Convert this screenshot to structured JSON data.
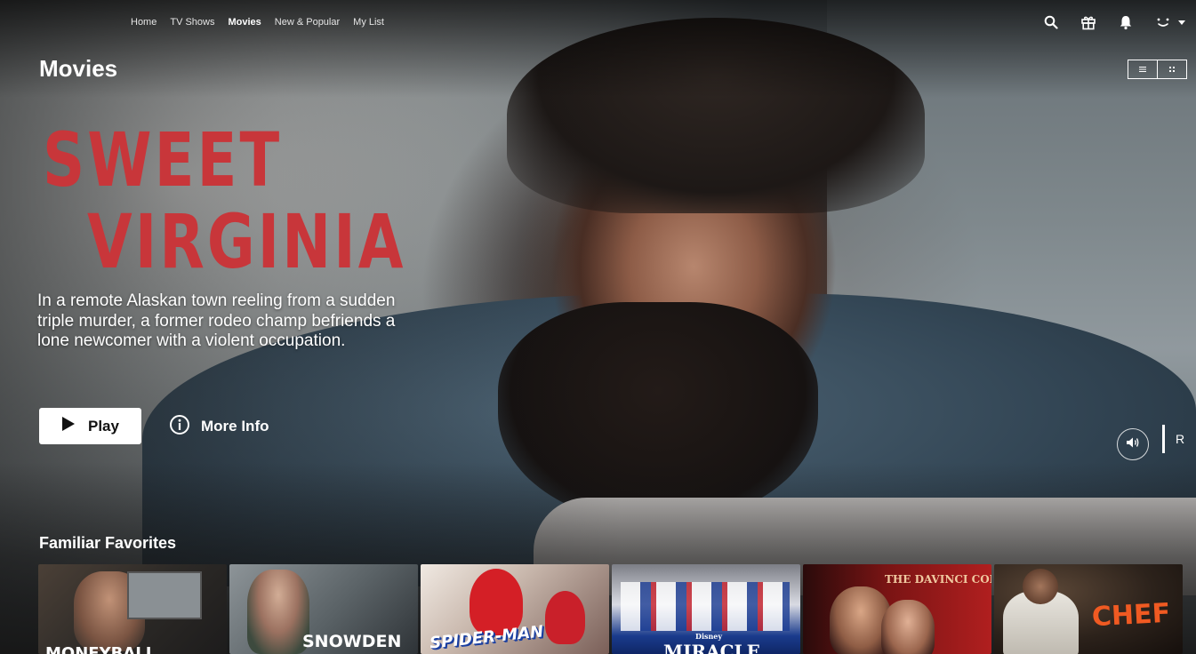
{
  "nav": {
    "links": [
      {
        "label": "Home",
        "active": false
      },
      {
        "label": "TV Shows",
        "active": false
      },
      {
        "label": "Movies",
        "active": true
      },
      {
        "label": "New & Popular",
        "active": false
      },
      {
        "label": "My List",
        "active": false
      }
    ],
    "icons": [
      "search-icon",
      "gift-icon",
      "bell-icon",
      "profile-avatar",
      "caret-down-icon"
    ]
  },
  "page": {
    "title": "Movies"
  },
  "hero": {
    "title_line1": "SWEET",
    "title_line2": "VIRGINIA",
    "synopsis": "In a remote Alaskan town reeling from a sudden triple murder, a former rodeo champ befriends a lone newcomer with a violent occupation.",
    "play_label": "Play",
    "info_label": "More Info",
    "rating": "R",
    "title_color": "#c8363a"
  },
  "row": {
    "title": "Familiar Favorites",
    "tiles": [
      {
        "name": "Moneyball",
        "text": "MONEYBALL"
      },
      {
        "name": "Snowden",
        "text": "SNOWDEN"
      },
      {
        "name": "Spider-Man",
        "text": "SPIDER-MAN"
      },
      {
        "name": "Miracle",
        "text": "MIRACLE",
        "badge": "Disney"
      },
      {
        "name": "The Da Vinci Code",
        "text": "THE DAVINCI CODE"
      },
      {
        "name": "Chef",
        "text": "CHEF"
      }
    ]
  }
}
